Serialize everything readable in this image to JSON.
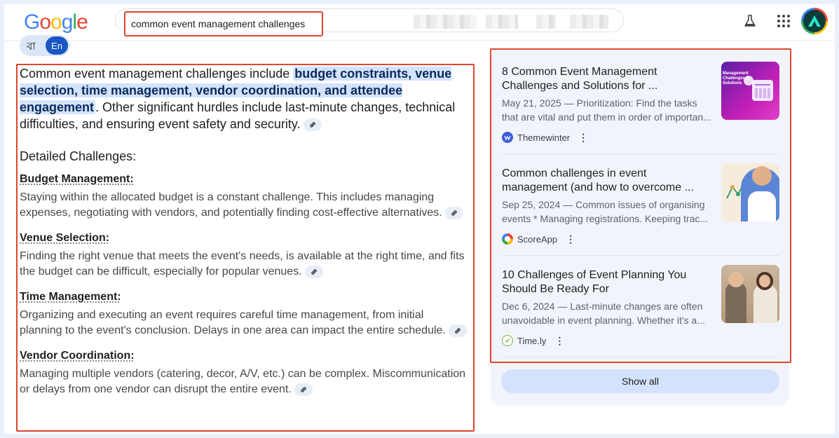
{
  "header": {
    "logo": [
      "G",
      "o",
      "o",
      "g",
      "l",
      "e"
    ],
    "logo_colors": [
      "#4285f4",
      "#ea4335",
      "#fbbc05",
      "#4285f4",
      "#34a853",
      "#ea4335"
    ],
    "search_value": "common event management challenges",
    "icons": [
      "labs-flask-icon",
      "apps-grid-icon"
    ]
  },
  "lang": {
    "bengali": "বা",
    "english": "En"
  },
  "answer": {
    "intro_start": "Common event management challenges include ",
    "intro_highlight": "budget constraints, venue selection, time management, vendor coordination, and attendee engagement",
    "intro_end": ". Other significant hurdles include last-minute changes, technical difficulties, and ensuring event safety and security.",
    "section_title": "Detailed Challenges:",
    "items": [
      {
        "title": "Budget Management:",
        "body": "Staying within the allocated budget is a constant challenge. This includes managing expenses, negotiating with vendors, and potentially finding cost-effective alternatives."
      },
      {
        "title": "Venue Selection:",
        "body": "Finding the right venue that meets the event's needs, is available at the right time, and fits the budget can be difficult, especially for popular venues."
      },
      {
        "title": "Time Management:",
        "body": "Organizing and executing an event requires careful time management, from initial planning to the event's conclusion. Delays in one area can impact the entire schedule."
      },
      {
        "title": "Vendor Coordination:",
        "body": "Managing multiple vendors (catering, decor, A/V, etc.) can be complex. Miscommunication or delays from one vendor can disrupt the entire event."
      }
    ]
  },
  "sources": {
    "cards": [
      {
        "title": "8 Common Event Management Challenges and Solutions for ...",
        "snippet": "May 21, 2025 — Prioritization: Find the tasks that are vital and put them in order of importan...",
        "source": "Themewinter",
        "fav_color": "#3b5bdb",
        "thumb_text": "Management Challenges & Solutions"
      },
      {
        "title": "Common challenges in event management (and how to overcome ...",
        "snippet": "Sep 25, 2024 — Common issues of organising events * Managing registrations. Keeping trac...",
        "source": "ScoreApp",
        "fav_color": "#34a853"
      },
      {
        "title": "10 Challenges of Event Planning You Should Be Ready For",
        "snippet": "Dec 6, 2024 — Last-minute changes are often unavoidable in event planning. Whether it's a...",
        "source": "Time.ly",
        "fav_color": "#7cb342"
      }
    ],
    "more_icon": "⋮",
    "show_all": "Show all"
  }
}
